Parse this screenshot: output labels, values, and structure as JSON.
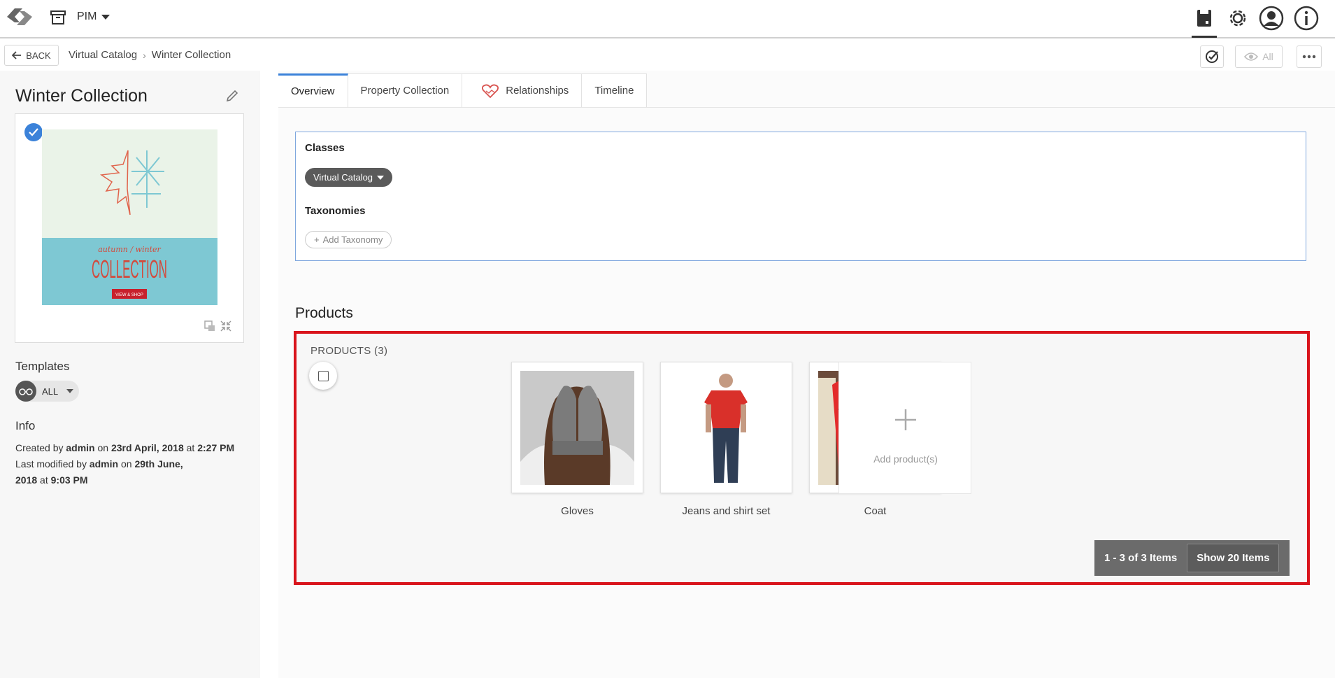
{
  "topbar": {
    "module_label": "PIM",
    "icons": [
      "logo-icon",
      "archive-icon",
      "catalog-icon",
      "gear-icon",
      "user-icon",
      "info-icon"
    ]
  },
  "subbar": {
    "back_label": "BACK",
    "breadcrumb": [
      "Virtual Catalog",
      "Winter Collection"
    ],
    "view_label": "All"
  },
  "left": {
    "title": "Winter Collection",
    "thumbnail": {
      "line1": "autumn / winter",
      "line2": "COLLECTION",
      "cta": "VIEW & SHOP"
    },
    "templates_label": "Templates",
    "template_value": "ALL",
    "info_label": "Info",
    "info": {
      "created_prefix": "Created by",
      "created_user": "admin",
      "created_on": "on",
      "created_date": "23rd April, 2018",
      "created_at": "at",
      "created_time": "2:27 PM",
      "modified_prefix": "Last modified by",
      "modified_user": "admin",
      "modified_on": "on",
      "modified_date": "29th June, 2018",
      "modified_at": "at",
      "modified_time": "9:03 PM"
    }
  },
  "tabs": [
    {
      "label": "Overview",
      "active": true
    },
    {
      "label": "Property Collection",
      "active": false
    },
    {
      "label": "Relationships",
      "active": false
    },
    {
      "label": "Timeline",
      "active": false
    }
  ],
  "overview": {
    "classes_label": "Classes",
    "class_chip": "Virtual Catalog",
    "taxonomies_label": "Taxonomies",
    "add_taxonomy": "Add Taxonomy"
  },
  "products": {
    "heading": "Products",
    "count_label": "PRODUCTS (3)",
    "items": [
      {
        "name": "Gloves"
      },
      {
        "name": "Jeans and shirt set"
      },
      {
        "name": "Coat"
      }
    ],
    "add_label": "Add product(s)",
    "pager_range": "1 - 3 of 3 Items",
    "pager_show": "Show 20 Items"
  },
  "colors": {
    "accent": "#3b82d9",
    "highlight_border": "#d9141c",
    "chip_bg": "#5a5a5a",
    "pager_bg": "#6b6b6b"
  }
}
